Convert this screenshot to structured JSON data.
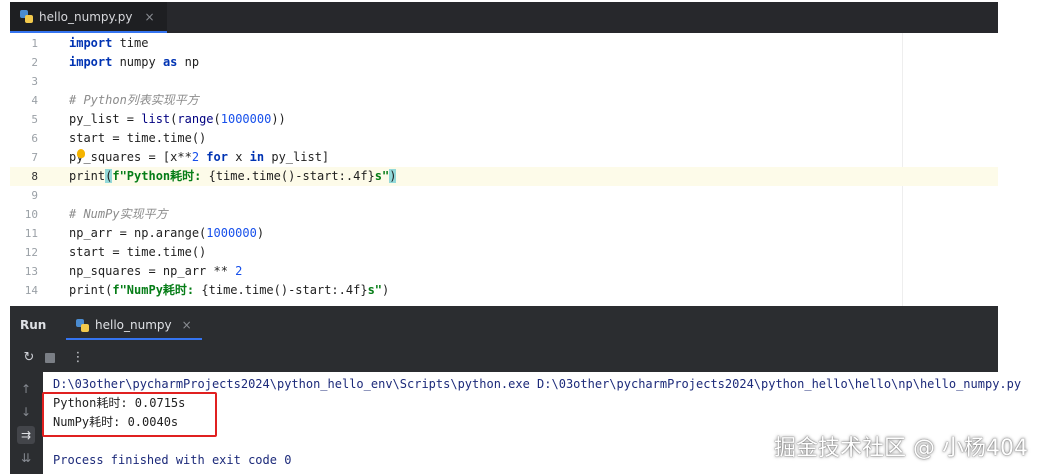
{
  "editor": {
    "tab_label": "hello_numpy.py",
    "tab_close": "×",
    "line_numbers": [
      "1",
      "2",
      "3",
      "4",
      "5",
      "6",
      "7",
      "8",
      "9",
      "10",
      "11",
      "12",
      "13",
      "14"
    ],
    "current_line": 8,
    "lines": {
      "l1_kw": "import",
      "l1_rest": " time",
      "l2_kw": "import",
      "l2_mid": " numpy ",
      "l2_kw2": "as",
      "l2_rest": " np",
      "l4_comment": "# Python列表实现平方",
      "l5_a": "py_list = ",
      "l5_bi1": "list",
      "l5_b": "(",
      "l5_bi2": "range",
      "l5_c": "(",
      "l5_num": "1000000",
      "l5_d": "))",
      "l6": "start = time.time()",
      "l7_a": "py_squares = [x**",
      "l7_num": "2",
      "l7_sp1": " ",
      "l7_kw1": "for",
      "l7_b": " x ",
      "l7_kw2": "in",
      "l7_c": " py_list]",
      "l8_fn": "print",
      "l8_open": "(",
      "l8_str1": "f\"Python耗时: ",
      "l8_expr": "{time.time()-start:.4f}",
      "l8_str2": "s\"",
      "l8_close": ")",
      "l10_comment": "# NumPy实现平方",
      "l11_a": "np_arr = np.arange(",
      "l11_num": "1000000",
      "l11_b": ")",
      "l12": "start = time.time()",
      "l13_a": "np_squares = np_arr ** ",
      "l13_num": "2",
      "l14_fn": "print",
      "l14_open": "(",
      "l14_str1": "f\"NumPy耗时: ",
      "l14_expr": "{time.time()-start:.4f}",
      "l14_str2": "s\"",
      "l14_close": ")"
    }
  },
  "run_panel": {
    "title": "Run",
    "tab_label": "hello_numpy",
    "tab_close": "×",
    "toolbar": {
      "rerun_icon": "↻",
      "more_icon": "⋮"
    },
    "side": {
      "up_icon": "↑",
      "down_icon": "↓",
      "wrap_icon": "⇉",
      "scroll_end_icon": "⇊"
    }
  },
  "console": {
    "command": "D:\\03other\\pycharmProjects2024\\python_hello_env\\Scripts\\python.exe D:\\03other\\pycharmProjects2024\\python_hello\\hello\\np\\hello_numpy.py",
    "output_python": "Python耗时: 0.0715s",
    "output_numpy": "NumPy耗时: 0.0040s",
    "finished": "Process finished with exit code 0"
  },
  "watermark": "掘金技术社区 @ 小杨404",
  "colors": {
    "accent": "#3574f0",
    "keyword": "#0033b3",
    "string": "#067d17",
    "number": "#1750eb",
    "highlight_box": "#e02020"
  }
}
